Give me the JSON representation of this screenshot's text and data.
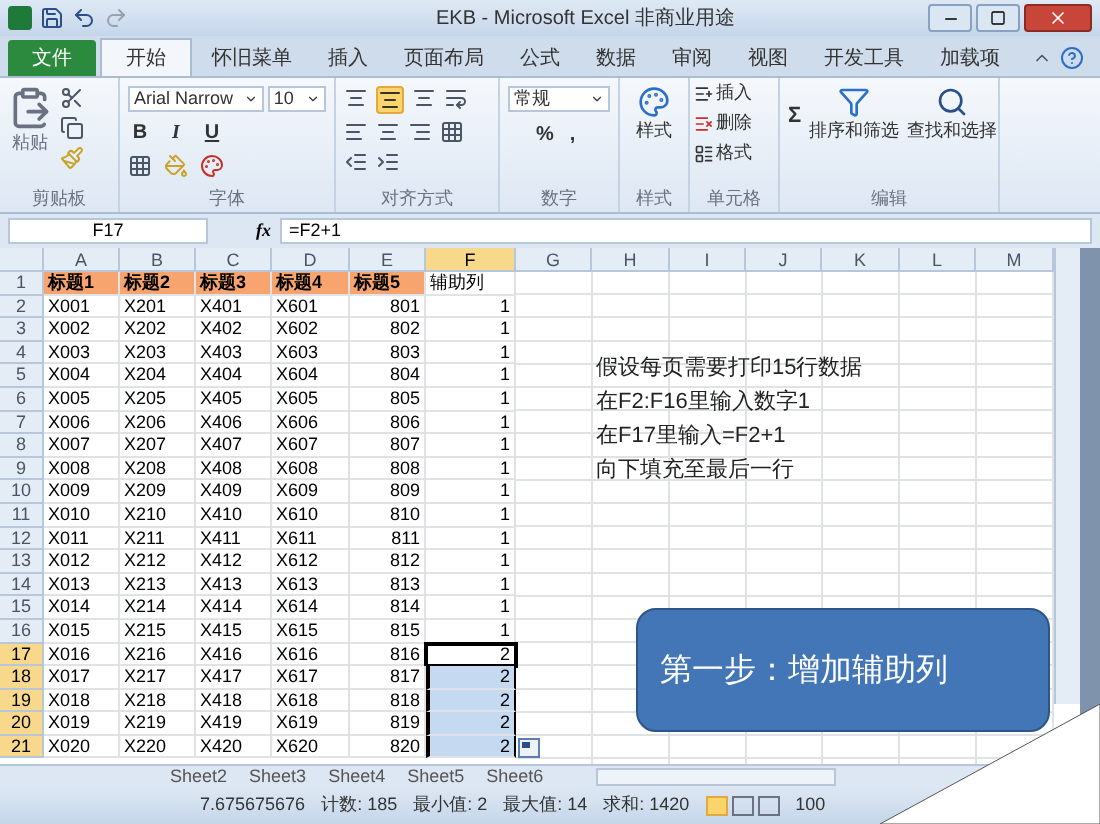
{
  "window": {
    "title": "EKB - Microsoft Excel 非商业用途"
  },
  "menu_tabs": [
    {
      "label": "文件",
      "kind": "file",
      "selected": false
    },
    {
      "label": "开始",
      "kind": "tab",
      "selected": true
    },
    {
      "label": "怀旧菜单",
      "kind": "tab",
      "selected": false
    },
    {
      "label": "插入",
      "kind": "tab",
      "selected": false
    },
    {
      "label": "页面布局",
      "kind": "tab",
      "selected": false
    },
    {
      "label": "公式",
      "kind": "tab",
      "selected": false
    },
    {
      "label": "数据",
      "kind": "tab",
      "selected": false
    },
    {
      "label": "审阅",
      "kind": "tab",
      "selected": false
    },
    {
      "label": "视图",
      "kind": "tab",
      "selected": false
    },
    {
      "label": "开发工具",
      "kind": "tab",
      "selected": false
    },
    {
      "label": "加载项",
      "kind": "tab",
      "selected": false
    }
  ],
  "ribbon": {
    "paste": "粘贴",
    "font": "Arial Narrow",
    "font_size": "10",
    "font_buttons": [
      "B",
      "I",
      "U"
    ],
    "number_format": "常规",
    "number_symbols": [
      "%",
      ","
    ],
    "styles": "样式",
    "cell_buttons": [
      "插入",
      "删除",
      "格式"
    ],
    "sum": "Σ",
    "sort": "排序和筛选",
    "find": "查找和选择",
    "groups": [
      "剪贴板",
      "字体",
      "对齐方式",
      "数字",
      "样式",
      "单元格",
      "编辑"
    ]
  },
  "formula_bar": {
    "name_box": "F17",
    "fx": "fx",
    "formula": "=F2+1"
  },
  "sheet": {
    "columns": [
      {
        "label": "A",
        "selected": false
      },
      {
        "label": "B",
        "selected": false
      },
      {
        "label": "C",
        "selected": false
      },
      {
        "label": "D",
        "selected": false
      },
      {
        "label": "E",
        "selected": false
      },
      {
        "label": "F",
        "selected": true
      },
      {
        "label": "G",
        "selected": false
      },
      {
        "label": "H",
        "selected": false
      },
      {
        "label": "I",
        "selected": false
      },
      {
        "label": "J",
        "selected": false
      },
      {
        "label": "K",
        "selected": false
      },
      {
        "label": "L",
        "selected": false
      },
      {
        "label": "M",
        "selected": false
      }
    ],
    "rows": [
      {
        "header": "1",
        "kind": "header",
        "selected": false,
        "active": false,
        "cells": [
          "标题1",
          "标题2",
          "标题3",
          "标题4",
          "标题5",
          "辅助列"
        ]
      },
      {
        "header": "2",
        "kind": "data",
        "selected": false,
        "active": false,
        "cells": [
          "X001",
          "X201",
          "X401",
          "X601",
          "801",
          "1"
        ]
      },
      {
        "header": "3",
        "kind": "data",
        "selected": false,
        "active": false,
        "cells": [
          "X002",
          "X202",
          "X402",
          "X602",
          "802",
          "1"
        ]
      },
      {
        "header": "4",
        "kind": "data",
        "selected": false,
        "active": false,
        "cells": [
          "X003",
          "X203",
          "X403",
          "X603",
          "803",
          "1"
        ]
      },
      {
        "header": "5",
        "kind": "data",
        "selected": false,
        "active": false,
        "cells": [
          "X004",
          "X204",
          "X404",
          "X604",
          "804",
          "1"
        ]
      },
      {
        "header": "6",
        "kind": "data",
        "selected": false,
        "active": false,
        "cells": [
          "X005",
          "X205",
          "X405",
          "X605",
          "805",
          "1"
        ]
      },
      {
        "header": "7",
        "kind": "data",
        "selected": false,
        "active": false,
        "cells": [
          "X006",
          "X206",
          "X406",
          "X606",
          "806",
          "1"
        ]
      },
      {
        "header": "8",
        "kind": "data",
        "selected": false,
        "active": false,
        "cells": [
          "X007",
          "X207",
          "X407",
          "X607",
          "807",
          "1"
        ]
      },
      {
        "header": "9",
        "kind": "data",
        "selected": false,
        "active": false,
        "cells": [
          "X008",
          "X208",
          "X408",
          "X608",
          "808",
          "1"
        ]
      },
      {
        "header": "10",
        "kind": "data",
        "selected": false,
        "active": false,
        "cells": [
          "X009",
          "X209",
          "X409",
          "X609",
          "809",
          "1"
        ]
      },
      {
        "header": "11",
        "kind": "data",
        "selected": false,
        "active": false,
        "cells": [
          "X010",
          "X210",
          "X410",
          "X610",
          "810",
          "1"
        ]
      },
      {
        "header": "12",
        "kind": "data",
        "selected": false,
        "active": false,
        "cells": [
          "X011",
          "X211",
          "X411",
          "X611",
          "811",
          "1"
        ]
      },
      {
        "header": "13",
        "kind": "data",
        "selected": false,
        "active": false,
        "cells": [
          "X012",
          "X212",
          "X412",
          "X612",
          "812",
          "1"
        ]
      },
      {
        "header": "14",
        "kind": "data",
        "selected": false,
        "active": false,
        "cells": [
          "X013",
          "X213",
          "X413",
          "X613",
          "813",
          "1"
        ]
      },
      {
        "header": "15",
        "kind": "data",
        "selected": false,
        "active": false,
        "cells": [
          "X014",
          "X214",
          "X414",
          "X614",
          "814",
          "1"
        ]
      },
      {
        "header": "16",
        "kind": "data",
        "selected": false,
        "active": false,
        "cells": [
          "X015",
          "X215",
          "X415",
          "X615",
          "815",
          "1"
        ]
      },
      {
        "header": "17",
        "kind": "data",
        "selected": true,
        "active": true,
        "cells": [
          "X016",
          "X216",
          "X416",
          "X616",
          "816",
          "2"
        ]
      },
      {
        "header": "18",
        "kind": "data",
        "selected": true,
        "active": false,
        "cells": [
          "X017",
          "X217",
          "X417",
          "X617",
          "817",
          "2"
        ]
      },
      {
        "header": "19",
        "kind": "data",
        "selected": true,
        "active": false,
        "cells": [
          "X018",
          "X218",
          "X418",
          "X618",
          "818",
          "2"
        ]
      },
      {
        "header": "20",
        "kind": "data",
        "selected": true,
        "active": false,
        "cells": [
          "X019",
          "X219",
          "X419",
          "X619",
          "819",
          "2"
        ]
      },
      {
        "header": "21",
        "kind": "data",
        "selected": true,
        "active": false,
        "cells": [
          "X020",
          "X220",
          "X420",
          "X620",
          "820",
          "2"
        ]
      }
    ]
  },
  "notes": [
    "假设每页需要打印15行数据",
    "在F2:F16里输入数字1",
    "在F17里输入=F2+1",
    "向下填充至最后一行"
  ],
  "callout": "第一步：增加辅助列",
  "sheet_tabs": [
    {
      "label": "Sheet2",
      "selected": false
    },
    {
      "label": "Sheet3",
      "selected": false
    },
    {
      "label": "Sheet4",
      "selected": false
    },
    {
      "label": "Sheet5",
      "selected": false
    },
    {
      "label": "Sheet6",
      "selected": false
    }
  ],
  "status_bar": {
    "items": [
      "7.675675676",
      "计数: 185",
      "最小值: 2",
      "最大值: 14",
      "求和: 1420"
    ],
    "zoom": "100"
  }
}
